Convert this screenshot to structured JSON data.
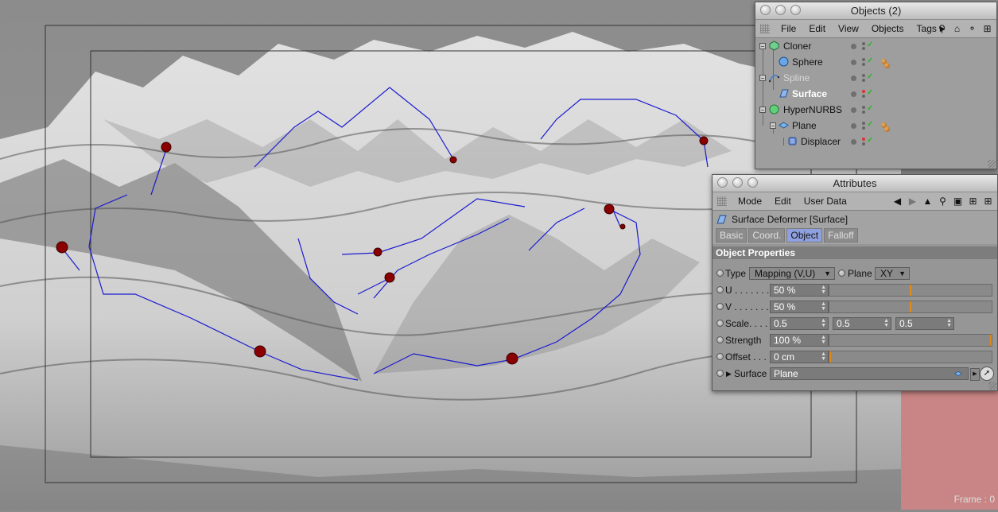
{
  "viewport": {
    "frame_readout": "Frame : 0"
  },
  "objects_window": {
    "title": "Objects (2)",
    "menu": [
      "File",
      "Edit",
      "View",
      "Objects",
      "Tags"
    ],
    "items": [
      {
        "name": "Cloner",
        "icon": "cloner-icon",
        "tags": false
      },
      {
        "name": "Sphere",
        "icon": "sphere-icon",
        "tags": true
      },
      {
        "name": "Spline",
        "icon": "spline-icon",
        "tags": false
      },
      {
        "name": "Surface",
        "icon": "surface-deformer-icon",
        "tags": false
      },
      {
        "name": "HyperNURBS",
        "icon": "hypernurbs-icon",
        "tags": false
      },
      {
        "name": "Plane",
        "icon": "plane-icon",
        "tags": true
      },
      {
        "name": "Displacer",
        "icon": "displacer-icon",
        "tags": false
      }
    ]
  },
  "attributes_window": {
    "title": "Attributes",
    "menu": [
      "Mode",
      "Edit",
      "User Data"
    ],
    "object_title": "Surface Deformer [Surface]",
    "tabs": [
      "Basic",
      "Coord.",
      "Object",
      "Falloff"
    ],
    "active_tab": "Object",
    "section": "Object Properties",
    "type": {
      "label": "Type",
      "value": "Mapping (V,U)"
    },
    "plane": {
      "label": "Plane",
      "value": "XY"
    },
    "u": {
      "label": "U . . . . . . .",
      "value": "50 %",
      "level": 0.5
    },
    "v": {
      "label": "V . . . . . . .",
      "value": "50 %",
      "level": 0.5
    },
    "scale": {
      "label": "Scale. . . .",
      "x": "0.5",
      "y": "0.5",
      "z": "0.5"
    },
    "strength": {
      "label": "Strength",
      "value": "100 %",
      "level": 1.0
    },
    "offset": {
      "label": "Offset . . .",
      "value": "0 cm",
      "level": 0.0
    },
    "surface": {
      "label": "Surface",
      "value": "Plane"
    }
  }
}
